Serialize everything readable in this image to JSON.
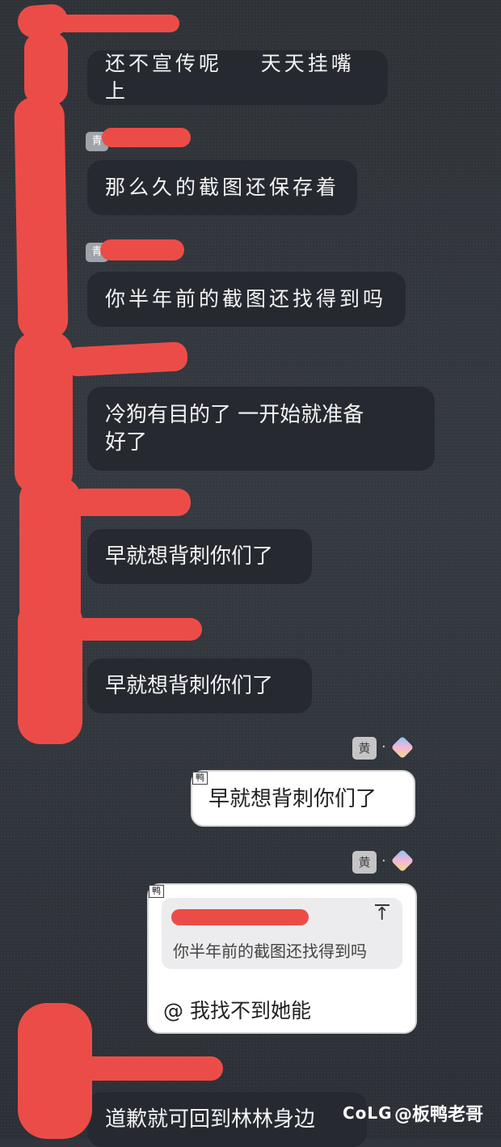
{
  "messages": {
    "m1": "还不宣传呢    天天挂嘴上",
    "m2": "那么久的截图还保存着",
    "m3": "你半年前的截图还找得到吗",
    "m4": "冷狗有目的了 一开始就准备\n好了",
    "m5": "早就想背刺你们了",
    "m6": "早就想背刺你们了",
    "m7": "早就想背刺你们了",
    "m8_quote": "你半年前的截图还找得到吗",
    "m8_reply": "@ 我找不到她能",
    "m9": "道歉就可回到林林身边"
  },
  "badges": {
    "qing": "青",
    "huang": "黄",
    "ya": "鸭",
    "dot": "."
  },
  "watermark": {
    "logo": "CoLG",
    "handle": "@板鸭老哥"
  },
  "icons": {
    "quote_arrow": "↑"
  },
  "colors": {
    "background": "#31363d",
    "bubble_dark": "#262a30",
    "redaction": "#ec4c47",
    "bubble_light": "#ffffff"
  }
}
